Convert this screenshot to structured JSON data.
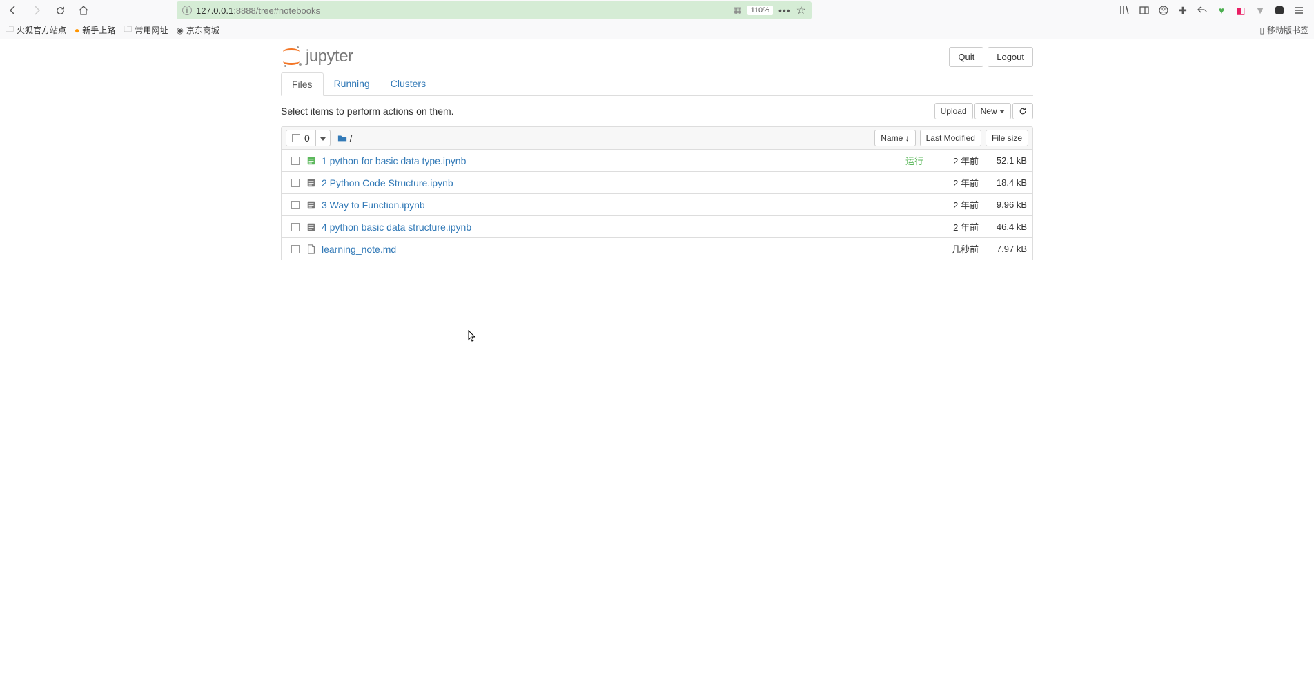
{
  "browser": {
    "url_host": "127.0.0.1",
    "url_rest": ":8888/tree#notebooks",
    "zoom": "110%",
    "bookmarks": [
      {
        "label": "火狐官方站点",
        "icon": "folder"
      },
      {
        "label": "新手上路",
        "icon": "firefox"
      },
      {
        "label": "常用网址",
        "icon": "folder"
      },
      {
        "label": "京东商城",
        "icon": "jd"
      }
    ],
    "mobile_bookmarks": "移动版书签"
  },
  "header": {
    "logo_text": "jupyter",
    "quit": "Quit",
    "logout": "Logout"
  },
  "tabs": {
    "files": "Files",
    "running": "Running",
    "clusters": "Clusters"
  },
  "actions": {
    "hint": "Select items to perform actions on them.",
    "upload": "Upload",
    "new": "New"
  },
  "list_header": {
    "selected_count": "0",
    "breadcrumb": "/",
    "name": "Name",
    "last_modified": "Last Modified",
    "file_size": "File size"
  },
  "files": [
    {
      "name": "1 python for basic data type.ipynb",
      "icon": "notebook-running",
      "status": "运行",
      "modified": "2 年前",
      "size": "52.1 kB"
    },
    {
      "name": "2 Python Code Structure.ipynb",
      "icon": "notebook",
      "status": "",
      "modified": "2 年前",
      "size": "18.4 kB"
    },
    {
      "name": "3 Way to Function.ipynb",
      "icon": "notebook",
      "status": "",
      "modified": "2 年前",
      "size": "9.96 kB"
    },
    {
      "name": "4 python basic data structure.ipynb",
      "icon": "notebook",
      "status": "",
      "modified": "2 年前",
      "size": "46.4 kB"
    },
    {
      "name": "learning_note.md",
      "icon": "file",
      "status": "",
      "modified": "几秒前",
      "size": "7.97 kB"
    }
  ]
}
